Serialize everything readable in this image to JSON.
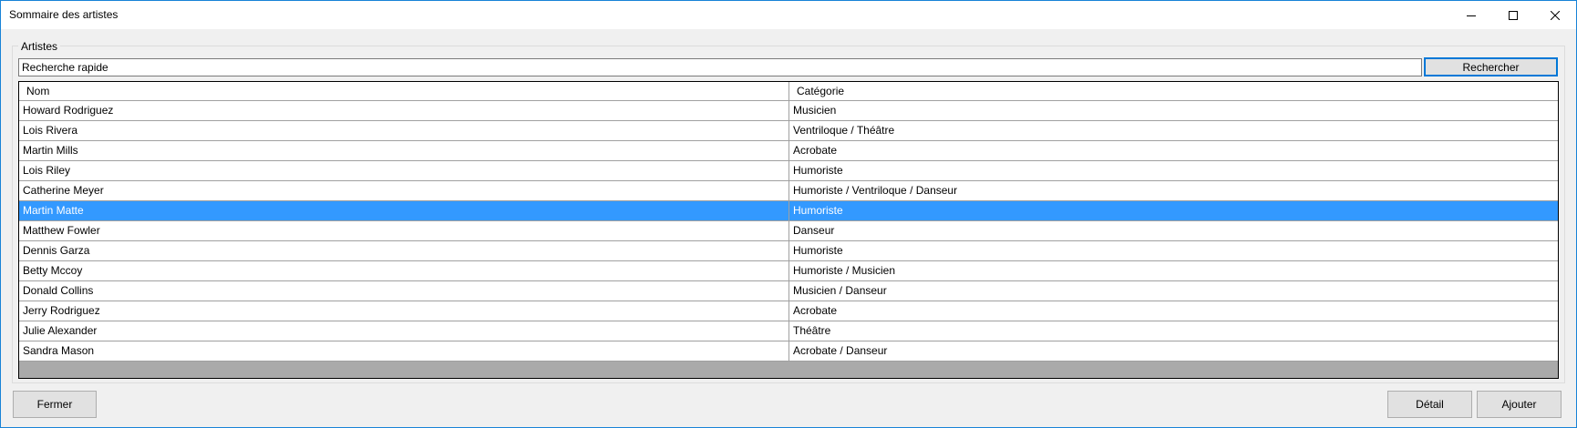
{
  "window": {
    "title": "Sommaire des artistes"
  },
  "group": {
    "legend": "Artistes"
  },
  "search": {
    "value": "Recherche rapide",
    "button_label": "Rechercher"
  },
  "table": {
    "columns": [
      "Nom",
      "Catégorie"
    ],
    "selected_index": 5,
    "rows": [
      {
        "name": "Howard Rodriguez",
        "category": "Musicien"
      },
      {
        "name": "Lois Rivera",
        "category": "Ventriloque / Théâtre"
      },
      {
        "name": "Martin Mills",
        "category": "Acrobate"
      },
      {
        "name": "Lois Riley",
        "category": "Humoriste"
      },
      {
        "name": "Catherine Meyer",
        "category": "Humoriste / Ventriloque / Danseur"
      },
      {
        "name": "Martin Matte",
        "category": "Humoriste"
      },
      {
        "name": "Matthew Fowler",
        "category": "Danseur"
      },
      {
        "name": "Dennis Garza",
        "category": "Humoriste"
      },
      {
        "name": "Betty Mccoy",
        "category": "Humoriste / Musicien"
      },
      {
        "name": "Donald Collins",
        "category": "Musicien / Danseur"
      },
      {
        "name": "Jerry Rodriguez",
        "category": "Acrobate"
      },
      {
        "name": "Julie Alexander",
        "category": "Théâtre"
      },
      {
        "name": "Sandra Mason",
        "category": "Acrobate / Danseur"
      }
    ]
  },
  "footer": {
    "close_label": "Fermer",
    "detail_label": "Détail",
    "add_label": "Ajouter"
  },
  "colors": {
    "selection": "#3399ff",
    "window_border": "#1883d7",
    "focus_border": "#0078d7"
  }
}
